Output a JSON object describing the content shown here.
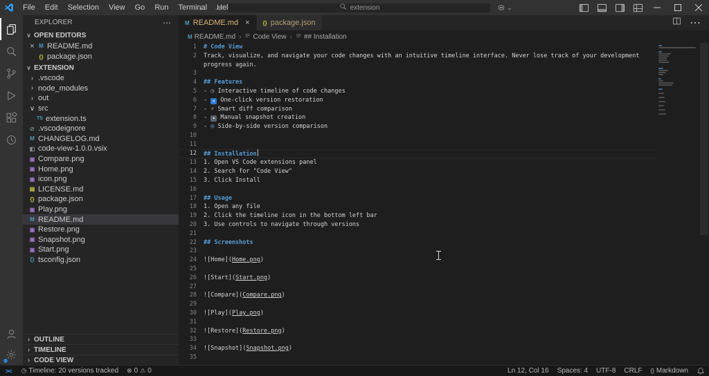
{
  "title_bar": {
    "menus": [
      "File",
      "Edit",
      "Selection",
      "View",
      "Go",
      "Run",
      "Terminal",
      "Help"
    ],
    "nav_back": "←",
    "nav_forward": "→",
    "search_value": "extension",
    "layout_icons": [
      "toggle-primary-sidebar",
      "toggle-panel",
      "toggle-secondary-sidebar",
      "customize-layout"
    ],
    "window_controls": [
      "minimize",
      "maximize",
      "close"
    ]
  },
  "activity_bar": {
    "top": [
      {
        "name": "explorer",
        "active": true
      },
      {
        "name": "search",
        "active": false
      },
      {
        "name": "source-control",
        "active": false
      },
      {
        "name": "run-and-debug",
        "active": false
      },
      {
        "name": "extensions",
        "active": false
      },
      {
        "name": "code-view",
        "active": false
      }
    ],
    "bottom": [
      {
        "name": "accounts",
        "badge": false
      },
      {
        "name": "manage",
        "badge": true
      }
    ]
  },
  "sidebar": {
    "title": "EXPLORER",
    "open_editors": {
      "label": "OPEN EDITORS",
      "items": [
        {
          "name": "README.md",
          "icon": "md",
          "close": "×"
        },
        {
          "name": "package.json",
          "icon": "json"
        }
      ]
    },
    "project": {
      "label": "EXTENSION",
      "items": [
        {
          "name": ".vscode",
          "chevron": "collapsed",
          "indent": 0
        },
        {
          "name": "node_modules",
          "chevron": "collapsed",
          "indent": 0
        },
        {
          "name": "out",
          "chevron": "collapsed",
          "indent": 0
        },
        {
          "name": "src",
          "chevron": "expanded",
          "indent": 0
        },
        {
          "name": "extension.ts",
          "icon": "ts",
          "indent": 1
        },
        {
          "name": ".vscodeignore",
          "icon": "vscodeignore",
          "indent": 0
        },
        {
          "name": "CHANGELOG.md",
          "icon": "md",
          "indent": 0
        },
        {
          "name": "code-view-1.0.0.vsix",
          "icon": "vsix",
          "indent": 0
        },
        {
          "name": "Compare.png",
          "icon": "image",
          "indent": 0
        },
        {
          "name": "Home.png",
          "icon": "image",
          "indent": 0
        },
        {
          "name": "icon.png",
          "icon": "image",
          "indent": 0
        },
        {
          "name": "LICENSE.md",
          "icon": "license",
          "indent": 0
        },
        {
          "name": "package.json",
          "icon": "json",
          "indent": 0
        },
        {
          "name": "Play.png",
          "icon": "image",
          "indent": 0
        },
        {
          "name": "README.md",
          "icon": "md",
          "indent": 0,
          "selected": true
        },
        {
          "name": "Restore.png",
          "icon": "image",
          "indent": 0
        },
        {
          "name": "Snapshot.png",
          "icon": "image",
          "indent": 0
        },
        {
          "name": "Start.png",
          "icon": "image",
          "indent": 0
        },
        {
          "name": "tsconfig.json",
          "icon": "tsconfig",
          "indent": 0
        }
      ]
    },
    "bottom_sections": [
      "OUTLINE",
      "TIMELINE",
      "CODE VIEW"
    ]
  },
  "editor_tabs": [
    {
      "label": "README.md",
      "icon": "md",
      "active": true,
      "close": "×"
    },
    {
      "label": "package.json",
      "icon": "json",
      "active": false
    }
  ],
  "breadcrumb": [
    "README.md",
    "Code View",
    "## Installation"
  ],
  "editor": {
    "lines": [
      {
        "n": 1,
        "parts": [
          {
            "t": "# Code View",
            "s": "h"
          }
        ]
      },
      {
        "n": 2,
        "parts": [
          {
            "t": "Track, visualize, and navigate your code changes with an intuitive timeline interface. Never lose track of your development progress again.",
            "s": "p"
          }
        ]
      },
      {
        "n": 3,
        "parts": []
      },
      {
        "n": 4,
        "parts": [
          {
            "t": "## Features",
            "s": "h"
          }
        ]
      },
      {
        "n": 5,
        "parts": [
          {
            "t": "- ",
            "s": "p"
          },
          {
            "icon": "clock-emoji"
          },
          {
            "t": " Interactive timeline of code changes",
            "s": "p"
          }
        ]
      },
      {
        "n": 6,
        "parts": [
          {
            "t": "- ",
            "s": "p"
          },
          {
            "icon": "rewind-emoji"
          },
          {
            "t": " One-click version restoration",
            "s": "p"
          }
        ]
      },
      {
        "n": 7,
        "parts": [
          {
            "t": "- ",
            "s": "p"
          },
          {
            "icon": "zap-emoji"
          },
          {
            "t": " Smart diff comparison",
            "s": "p"
          }
        ]
      },
      {
        "n": 8,
        "parts": [
          {
            "t": "- ",
            "s": "p"
          },
          {
            "icon": "camera-emoji"
          },
          {
            "t": " Manual snapshot creation",
            "s": "p"
          }
        ]
      },
      {
        "n": 9,
        "parts": [
          {
            "t": "- ",
            "s": "p"
          },
          {
            "icon": "magnifier-emoji"
          },
          {
            "t": " Side-by-side version comparison",
            "s": "p"
          }
        ]
      },
      {
        "n": 10,
        "parts": []
      },
      {
        "n": 11,
        "parts": []
      },
      {
        "n": 12,
        "current": true,
        "parts": [
          {
            "t": "## Installation",
            "s": "h"
          },
          {
            "caret": true
          }
        ]
      },
      {
        "n": 13,
        "parts": [
          {
            "t": "1. Open VS Code extensions panel",
            "s": "p"
          }
        ]
      },
      {
        "n": 14,
        "parts": [
          {
            "t": "2. Search for \"Code View\"",
            "s": "p"
          }
        ]
      },
      {
        "n": 15,
        "parts": [
          {
            "t": "3. Click Install",
            "s": "p"
          }
        ]
      },
      {
        "n": 16,
        "parts": []
      },
      {
        "n": 17,
        "parts": [
          {
            "t": "## Usage",
            "s": "h"
          }
        ]
      },
      {
        "n": 18,
        "parts": [
          {
            "t": "1. Open any file",
            "s": "p"
          }
        ]
      },
      {
        "n": 19,
        "parts": [
          {
            "t": "2. Click the timeline icon in the bottom left bar",
            "s": "p"
          }
        ]
      },
      {
        "n": 20,
        "parts": [
          {
            "t": "3. Use controls to navigate through versions",
            "s": "p"
          }
        ]
      },
      {
        "n": 21,
        "parts": []
      },
      {
        "n": 22,
        "parts": [
          {
            "t": "## Screenshots",
            "s": "h"
          }
        ]
      },
      {
        "n": 23,
        "parts": []
      },
      {
        "n": 24,
        "parts": [
          {
            "t": "![Home](",
            "s": "p"
          },
          {
            "t": "Home.png",
            "s": "lk"
          },
          {
            "t": ")",
            "s": "p"
          }
        ]
      },
      {
        "n": 25,
        "parts": []
      },
      {
        "n": 26,
        "parts": [
          {
            "t": "![Start](",
            "s": "p"
          },
          {
            "t": "Start.png",
            "s": "lk"
          },
          {
            "t": ")",
            "s": "p"
          }
        ]
      },
      {
        "n": 27,
        "parts": []
      },
      {
        "n": 28,
        "parts": [
          {
            "t": "![Compare](",
            "s": "p"
          },
          {
            "t": "Compare.png",
            "s": "lk"
          },
          {
            "t": ")",
            "s": "p"
          }
        ]
      },
      {
        "n": 29,
        "parts": []
      },
      {
        "n": 30,
        "parts": [
          {
            "t": "![Play](",
            "s": "p"
          },
          {
            "t": "Play.png",
            "s": "lk"
          },
          {
            "t": ")",
            "s": "p"
          }
        ]
      },
      {
        "n": 31,
        "parts": []
      },
      {
        "n": 32,
        "parts": [
          {
            "t": "![Restore](",
            "s": "p"
          },
          {
            "t": "Restore.png",
            "s": "lk"
          },
          {
            "t": ")",
            "s": "p"
          }
        ]
      },
      {
        "n": 33,
        "parts": []
      },
      {
        "n": 34,
        "parts": [
          {
            "t": "![Snapshot](",
            "s": "p"
          },
          {
            "t": "Snapshot.png",
            "s": "lk"
          },
          {
            "t": ")",
            "s": "p"
          }
        ]
      },
      {
        "n": 35,
        "parts": []
      }
    ]
  },
  "status_bar": {
    "remote_glyph": "><",
    "timeline_label": "Timeline: 20 versions tracked",
    "errors": "0",
    "warnings": "0",
    "cursor_position": "Ln 12, Col 16",
    "indentation": "Spaces: 4",
    "encoding": "UTF-8",
    "eol": "CRLF",
    "language": "Markdown"
  },
  "colors": {
    "accent_blue": "#569cd6",
    "tab_modified_gold": "#dcb67a",
    "badge_blue": "#2a7fd4",
    "remote_blue": "#3b8eea"
  }
}
